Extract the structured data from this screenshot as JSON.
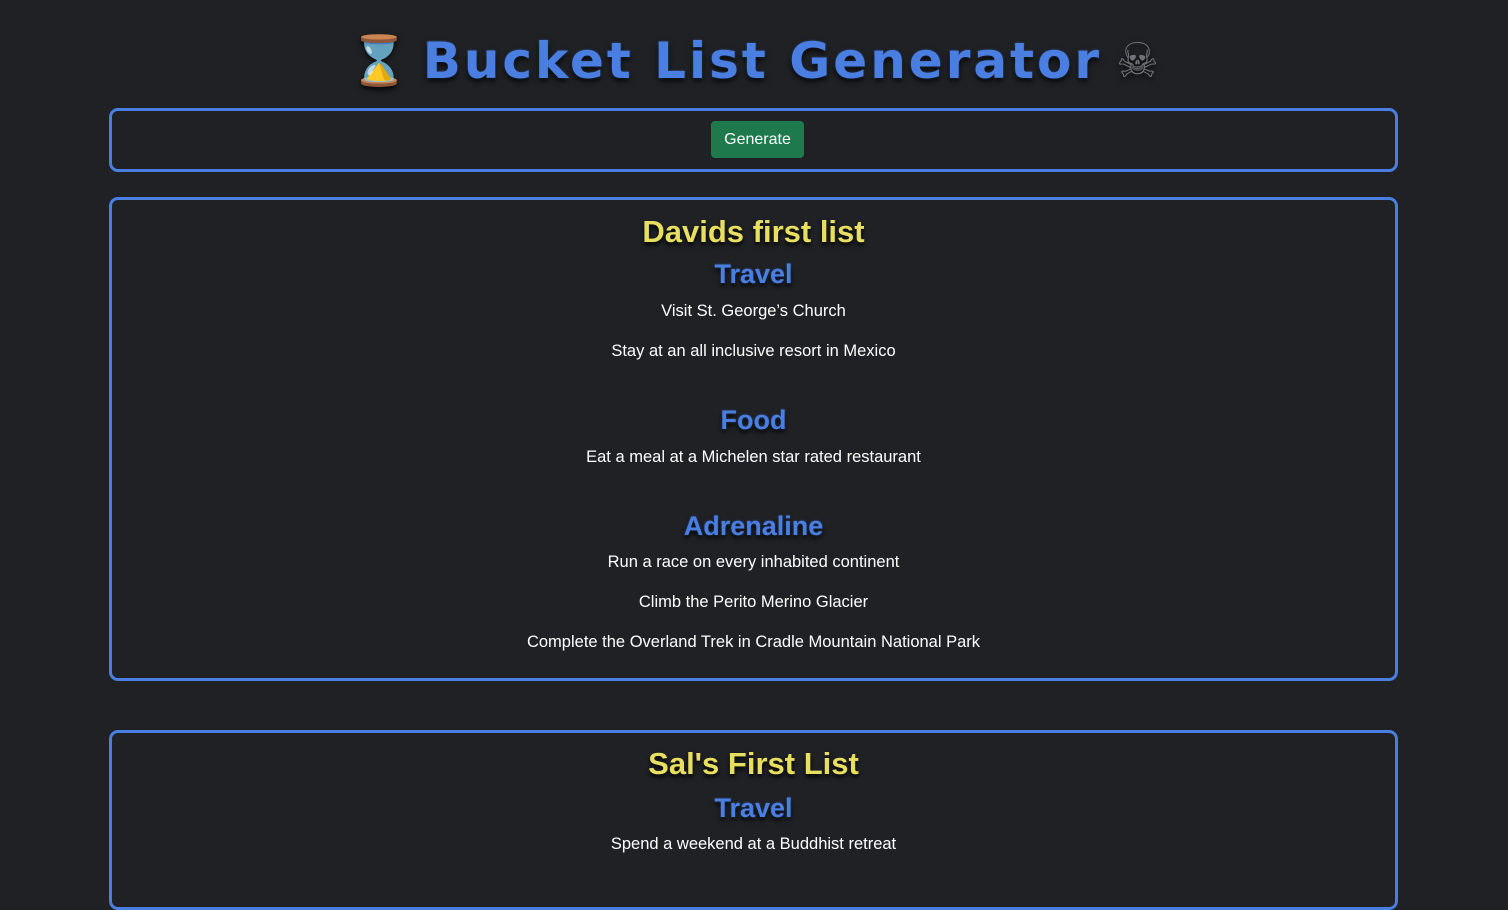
{
  "header": {
    "title": "Bucket List Generator",
    "left_icon": "⌛",
    "right_icon": "☠"
  },
  "generate": {
    "label": "Generate"
  },
  "lists": [
    {
      "title": "Davids first list",
      "categories": [
        {
          "name": "Travel",
          "items": [
            "Visit St. George’s Church",
            "Stay at an all inclusive resort in Mexico"
          ]
        },
        {
          "name": "Food",
          "items": [
            "Eat a meal at a Michelen star rated restaurant"
          ]
        },
        {
          "name": "Adrenaline",
          "items": [
            "Run a race on every inhabited continent",
            "Climb the Perito Merino Glacier",
            "Complete the Overland Trek in Cradle Mountain National Park"
          ]
        }
      ]
    },
    {
      "title": "Sal's First List",
      "categories": [
        {
          "name": "Travel",
          "items": [
            "Spend a weekend at a Buddhist retreat"
          ]
        }
      ]
    }
  ],
  "colors": {
    "background": "#1f2125",
    "accent_blue": "#4a7ee0",
    "title_yellow": "#e8df60",
    "button_green": "#1e7a4c"
  }
}
